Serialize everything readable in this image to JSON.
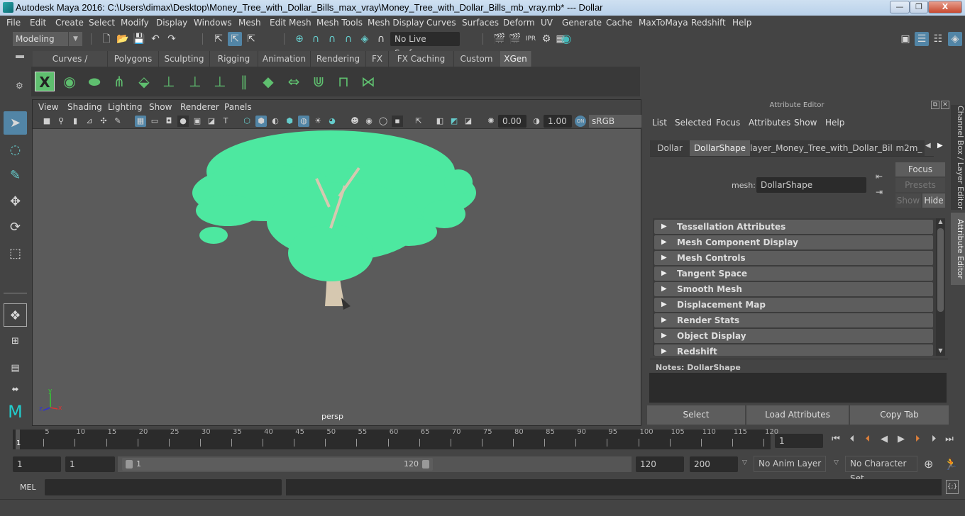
{
  "window": {
    "title": "Autodesk Maya 2016: C:\\Users\\dimax\\Desktop\\Money_Tree_with_Dollar_Bills_max_vray\\Money_Tree_with_Dollar_Bills_mb_vray.mb*   ---   Dollar",
    "minimize": "—",
    "restore": "❐",
    "close": "X"
  },
  "menubar": [
    "File",
    "Edit",
    "Create",
    "Select",
    "Modify",
    "Display",
    "Windows",
    "Mesh",
    "Edit Mesh",
    "Mesh Tools",
    "Mesh Display",
    "Curves",
    "Surfaces",
    "Deform",
    "UV",
    "Generate",
    "Cache",
    "MaxToMaya",
    "Redshift",
    "Help"
  ],
  "statusline": {
    "mode": "Modeling",
    "live_surface": "No Live Surface"
  },
  "shelf": {
    "tabs": [
      "Curves / Surfaces",
      "Polygons",
      "Sculpting",
      "Rigging",
      "Animation",
      "Rendering",
      "FX",
      "FX Caching",
      "Custom",
      "XGen"
    ],
    "active_tab": "XGen"
  },
  "viewport": {
    "menu": [
      "View",
      "Shading",
      "Lighting",
      "Show",
      "Renderer",
      "Panels"
    ],
    "exposure": "0.00",
    "gamma": "1.00",
    "color_space": "sRGB gamma",
    "camera_label": "persp",
    "axis": {
      "x": "x",
      "y": "y",
      "z": "z"
    }
  },
  "attribute_editor": {
    "title": "Attribute Editor",
    "menu": [
      "List",
      "Selected",
      "Focus",
      "Attributes",
      "Show",
      "Help"
    ],
    "tabs": [
      "Dollar",
      "DollarShape",
      "layer_Money_Tree_with_Dollar_Bills",
      "m2m_"
    ],
    "active_tab": "DollarShape",
    "mesh_label": "mesh:",
    "mesh_value": "DollarShape",
    "focus_btn": "Focus",
    "presets_btn": "Presets",
    "show_btn": "Show",
    "hide_btn": "Hide",
    "sections": [
      "Tessellation Attributes",
      "Mesh Component Display",
      "Mesh Controls",
      "Tangent Space",
      "Smooth Mesh",
      "Displacement Map",
      "Render Stats",
      "Object Display",
      "Redshift"
    ],
    "notes_label": "Notes:  DollarShape",
    "notes_value": "",
    "buttons": [
      "Select",
      "Load Attributes",
      "Copy Tab"
    ]
  },
  "side_tabs": [
    "Channel Box / Layer Editor",
    "Attribute Editor"
  ],
  "timeline": {
    "ticks": [
      5,
      10,
      15,
      20,
      25,
      30,
      35,
      40,
      45,
      50,
      55,
      60,
      65,
      70,
      75,
      80,
      85,
      90,
      95,
      100,
      105,
      110,
      115,
      120
    ],
    "range_min": 1,
    "range_max": 120,
    "current_frame_marker": "1",
    "current_frame": "1"
  },
  "range": {
    "start": "1",
    "playback_start": "1",
    "slider_start": "1",
    "slider_end": "120",
    "playback_end": "120",
    "end": "200",
    "anim_layer": "No Anim Layer",
    "character_set": "No Character Set"
  },
  "commandline": {
    "label": "MEL",
    "input": "",
    "output": ""
  },
  "colors": {
    "accent": "#5285a6",
    "leaf": "#4de8a0",
    "trunk": "#d6c8b0",
    "playhead": "#e0803a"
  }
}
